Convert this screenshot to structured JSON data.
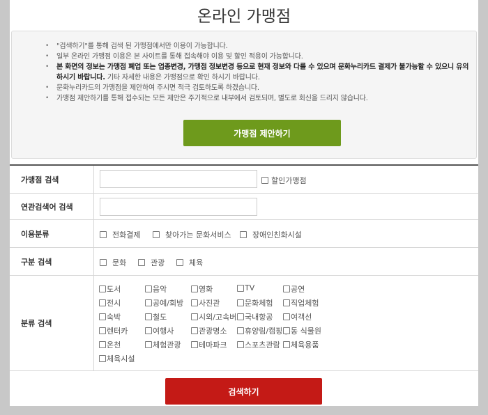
{
  "page": {
    "title": "온라인 가맹점"
  },
  "notice": {
    "items": [
      {
        "text": "\"검색하기\"를 통해 검색 된 가맹점에서만 이용이 가능합니다.",
        "bold": ""
      },
      {
        "text": "일부 온라인 가맹점 이용은 본 사이트를 통해 접속해야 이용 및 할인 적용이 가능합니다.",
        "bold": ""
      },
      {
        "text": " 기타 자세한 내용은 가맹점으로 확인 하시기 바랍니다.",
        "bold": "본 화면의 정보는 가맹점 폐업 또는 업종변경, 가맹점 정보변경 등으로 현재 정보와 다를 수 있으며 문화누리카드 결제가 불가능할 수 있으니 유의하시기 바랍니다."
      },
      {
        "text": "문화누리카드의 가맹점을 제안하여 주시면 적극 검토하도록 하겠습니다.",
        "bold": ""
      },
      {
        "text": "가맹점 제안하기를 통해 접수되는 모든 제안은 주기적으로 내부에서 검토되며, 별도로 회신을 드리지 않습니다.",
        "bold": ""
      }
    ],
    "suggest_button": "가맹점 제안하기"
  },
  "form": {
    "store_search": {
      "label": "가맹점 검색",
      "value": "",
      "discount_label": "할인가맹점"
    },
    "keyword_search": {
      "label": "연관검색어 검색",
      "value": ""
    },
    "usage": {
      "label": "이용분류",
      "options": [
        "전화결제",
        "찾아가는 문화서비스",
        "장애인친화시설"
      ]
    },
    "division": {
      "label": "구분 검색",
      "options": [
        "문화",
        "관광",
        "체육"
      ]
    },
    "category": {
      "label": "분류 검색",
      "options": [
        [
          "도서",
          "음악",
          "영화",
          "TV",
          "공연"
        ],
        [
          "전시",
          "공예/회방",
          "사진관",
          "문화체험",
          "직업체험"
        ],
        [
          "숙박",
          "철도",
          "시외/고속버스",
          "국내항공",
          "여객선"
        ],
        [
          "렌터카",
          "여행사",
          "관광명소",
          "휴양림/캠핑장",
          "동 식물원"
        ],
        [
          "온천",
          "체험관광",
          "테마파크",
          "스포츠관람",
          "체육용품"
        ],
        [
          "체육시설"
        ]
      ]
    }
  },
  "search_button": "검색하기",
  "colors": {
    "green": "#6e9a1c",
    "red": "#c41a16",
    "border": "#d6d6d6"
  }
}
